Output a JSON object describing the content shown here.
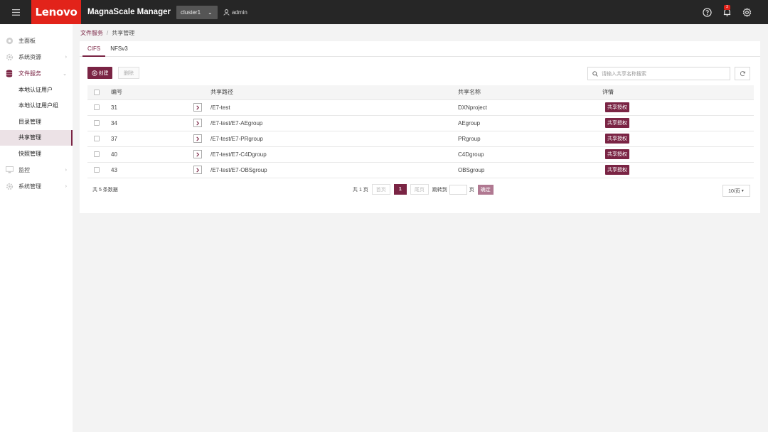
{
  "header": {
    "brand": "Lenovo",
    "app_title": "MagnaScale Manager",
    "cluster": "cluster1",
    "user": "admin",
    "notification_count": "3"
  },
  "sidebar": {
    "items": [
      {
        "label": "主面板",
        "icon": "dashboard-icon"
      },
      {
        "label": "系统资源",
        "icon": "resource-icon"
      },
      {
        "label": "文件服务",
        "icon": "database-icon"
      }
    ],
    "file_service_sub": [
      {
        "label": "本地认证用户"
      },
      {
        "label": "本地认证用户组"
      },
      {
        "label": "目录管理"
      },
      {
        "label": "共享管理"
      },
      {
        "label": "快照管理"
      }
    ],
    "bottom_items": [
      {
        "label": "监控",
        "icon": "monitor-icon"
      },
      {
        "label": "系统管理",
        "icon": "gear-icon"
      }
    ]
  },
  "breadcrumb": {
    "parent": "文件服务",
    "sep": "/",
    "current": "共享管理"
  },
  "tabs": [
    {
      "label": "CIFS"
    },
    {
      "label": "NFSv3"
    }
  ],
  "toolbar": {
    "create": "创建",
    "delete": "删除",
    "search_placeholder": "请输入共享名称搜索"
  },
  "table": {
    "headers": {
      "id": "编号",
      "path": "共享路径",
      "name": "共享名称",
      "detail": "详情"
    },
    "tag_label": "共享授权",
    "rows": [
      {
        "id": "31",
        "path": "/E7-test",
        "name": "DXNproject"
      },
      {
        "id": "34",
        "path": "/E7-test/E7-AEgroup",
        "name": "AEgroup"
      },
      {
        "id": "37",
        "path": "/E7-test/E7-PRgroup",
        "name": "PRgroup"
      },
      {
        "id": "40",
        "path": "/E7-test/E7-C4Dgroup",
        "name": "C4Dgroup"
      },
      {
        "id": "43",
        "path": "/E7-test/E7-OBSgroup",
        "name": "OBSgroup"
      }
    ]
  },
  "pagination": {
    "total": "共 5 条数据",
    "pages": "共 1 页",
    "first": "首页",
    "current": "1",
    "last": "尾页",
    "jump_label": "跳转到",
    "page_unit": "页",
    "confirm": "确定",
    "page_size": "10/页"
  },
  "colors": {
    "accent": "#7a2444",
    "topbar": "#262626",
    "brand": "#e2231a"
  }
}
